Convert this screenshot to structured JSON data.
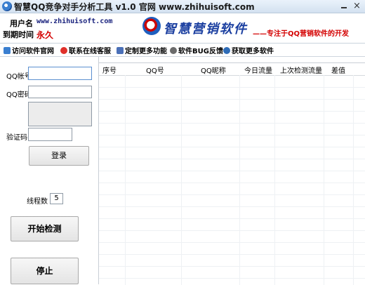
{
  "window": {
    "title": "智慧QQ竞争对手分析工具 v1.0    官网   www.zhihuisoft.com",
    "close_symbol": "×"
  },
  "header": {
    "user_label": "用户名",
    "user_value": "www.zhihuisoft.com",
    "expire_label": "到期时间",
    "expire_value": "永久",
    "logo_text": "智慧营销软件",
    "tagline": "——专注于QQ营销软件的开发"
  },
  "toolbar": {
    "items": [
      {
        "label": "访问软件官网",
        "icon": "home-icon"
      },
      {
        "label": "联系在线客服",
        "icon": "support-icon"
      },
      {
        "label": "定制更多功能",
        "icon": "customize-icon"
      },
      {
        "label": "软件BUG反馈",
        "icon": "bug-icon"
      },
      {
        "label": "获取更多软件",
        "icon": "download-icon"
      }
    ]
  },
  "login": {
    "qq_account_label": "QQ帐号",
    "qq_account_value": "",
    "qq_password_label": "QQ密码",
    "qq_password_value": "",
    "captcha_label": "验证码",
    "captcha_value": "",
    "login_button": "登录"
  },
  "controls": {
    "threads_label": "线程数",
    "threads_value": "5",
    "start_button": "开始检测",
    "stop_button": "停止"
  },
  "table": {
    "columns": [
      "序号",
      "QQ号",
      "QQ昵称",
      "今日流量",
      "上次检测流量",
      "差值"
    ],
    "rows": []
  },
  "colors": {
    "expire_red": "#d40000",
    "url_navy": "#1a237e",
    "logo_blue": "#1b3fa0"
  }
}
